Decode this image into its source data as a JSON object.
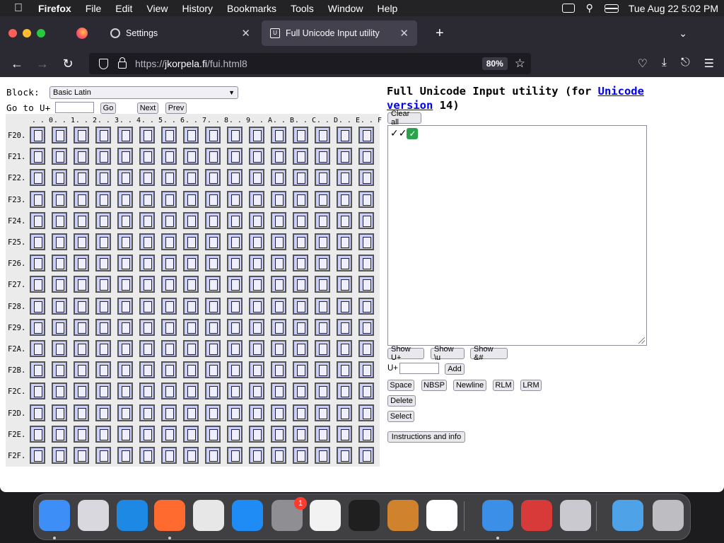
{
  "menubar": {
    "app_name": "Firefox",
    "menus": [
      "File",
      "Edit",
      "View",
      "History",
      "Bookmarks",
      "Tools",
      "Window",
      "Help"
    ],
    "datetime": "Tue Aug 22  5:02 PM"
  },
  "tabs": {
    "settings_label": "Settings",
    "active_label": "Full Unicode Input utility"
  },
  "navbar": {
    "url_prefix": "https://",
    "url_host": "jkorpela.fi",
    "url_path": "/fui.html8",
    "zoom": "80%"
  },
  "controls": {
    "block_label": "Block:",
    "block_value": "Basic Latin",
    "goto_label": "Go to U+",
    "go": "Go",
    "next": "Next",
    "prev": "Prev"
  },
  "grid": {
    "columns": [
      "0",
      "1",
      "2",
      "3",
      "4",
      "5",
      "6",
      "7",
      "8",
      "9",
      "A",
      "B",
      "C",
      "D",
      "E",
      "F"
    ],
    "rows": [
      "F20.",
      "F21.",
      "F22.",
      "F23.",
      "F24.",
      "F25.",
      "F26.",
      "F27.",
      "F28.",
      "F29.",
      "F2A.",
      "F2B.",
      "F2C.",
      "F2D.",
      "F2E.",
      "F2F."
    ]
  },
  "right": {
    "title_prefix": "Full Unicode Input utility (for ",
    "title_link1": "Unicode",
    "title_link2": "version",
    "title_suffix": " 14)",
    "clear_all": "Clear all",
    "text_content": "✓✓",
    "emoji_glyph": "✓",
    "show_u": "Show U+",
    "show_backslash": "Show \\u",
    "show_amp": "Show &#",
    "uplus_label": "U+",
    "add": "Add",
    "space": "Space",
    "nbsp": "NBSP",
    "newline": "Newline",
    "rlm": "RLM",
    "lrm": "LRM",
    "delete": "Delete",
    "select": "Select",
    "info": "Instructions and info"
  },
  "dock": {
    "badge_count": "1",
    "apps": [
      {
        "name": "finder-icon",
        "color": "#3d8ef7"
      },
      {
        "name": "launchpad-icon",
        "color": "#d8d8de"
      },
      {
        "name": "safari-icon",
        "color": "#1e88e5"
      },
      {
        "name": "firefox-icon",
        "color": "#ff6a2f"
      },
      {
        "name": "chrome-icon",
        "color": "#e7e7e7"
      },
      {
        "name": "app-store-icon",
        "color": "#1f8cf5"
      },
      {
        "name": "system-settings-icon",
        "color": "#8e8e93"
      },
      {
        "name": "textedit-icon",
        "color": "#f2f2f2"
      },
      {
        "name": "terminal-icon",
        "color": "#1f1f1f"
      },
      {
        "name": "garageband-icon",
        "color": "#d1822d"
      },
      {
        "name": "vscode-icon",
        "color": "#ffffff"
      },
      {
        "name": "weather-icon",
        "color": "#3c8fe6"
      },
      {
        "name": "photo-booth-icon",
        "color": "#d83a3a"
      },
      {
        "name": "font-book-icon",
        "color": "#c9c9cf"
      },
      {
        "name": "downloads-folder-icon",
        "color": "#4ea3e8"
      },
      {
        "name": "trash-icon",
        "color": "#bdbdc2"
      }
    ]
  }
}
